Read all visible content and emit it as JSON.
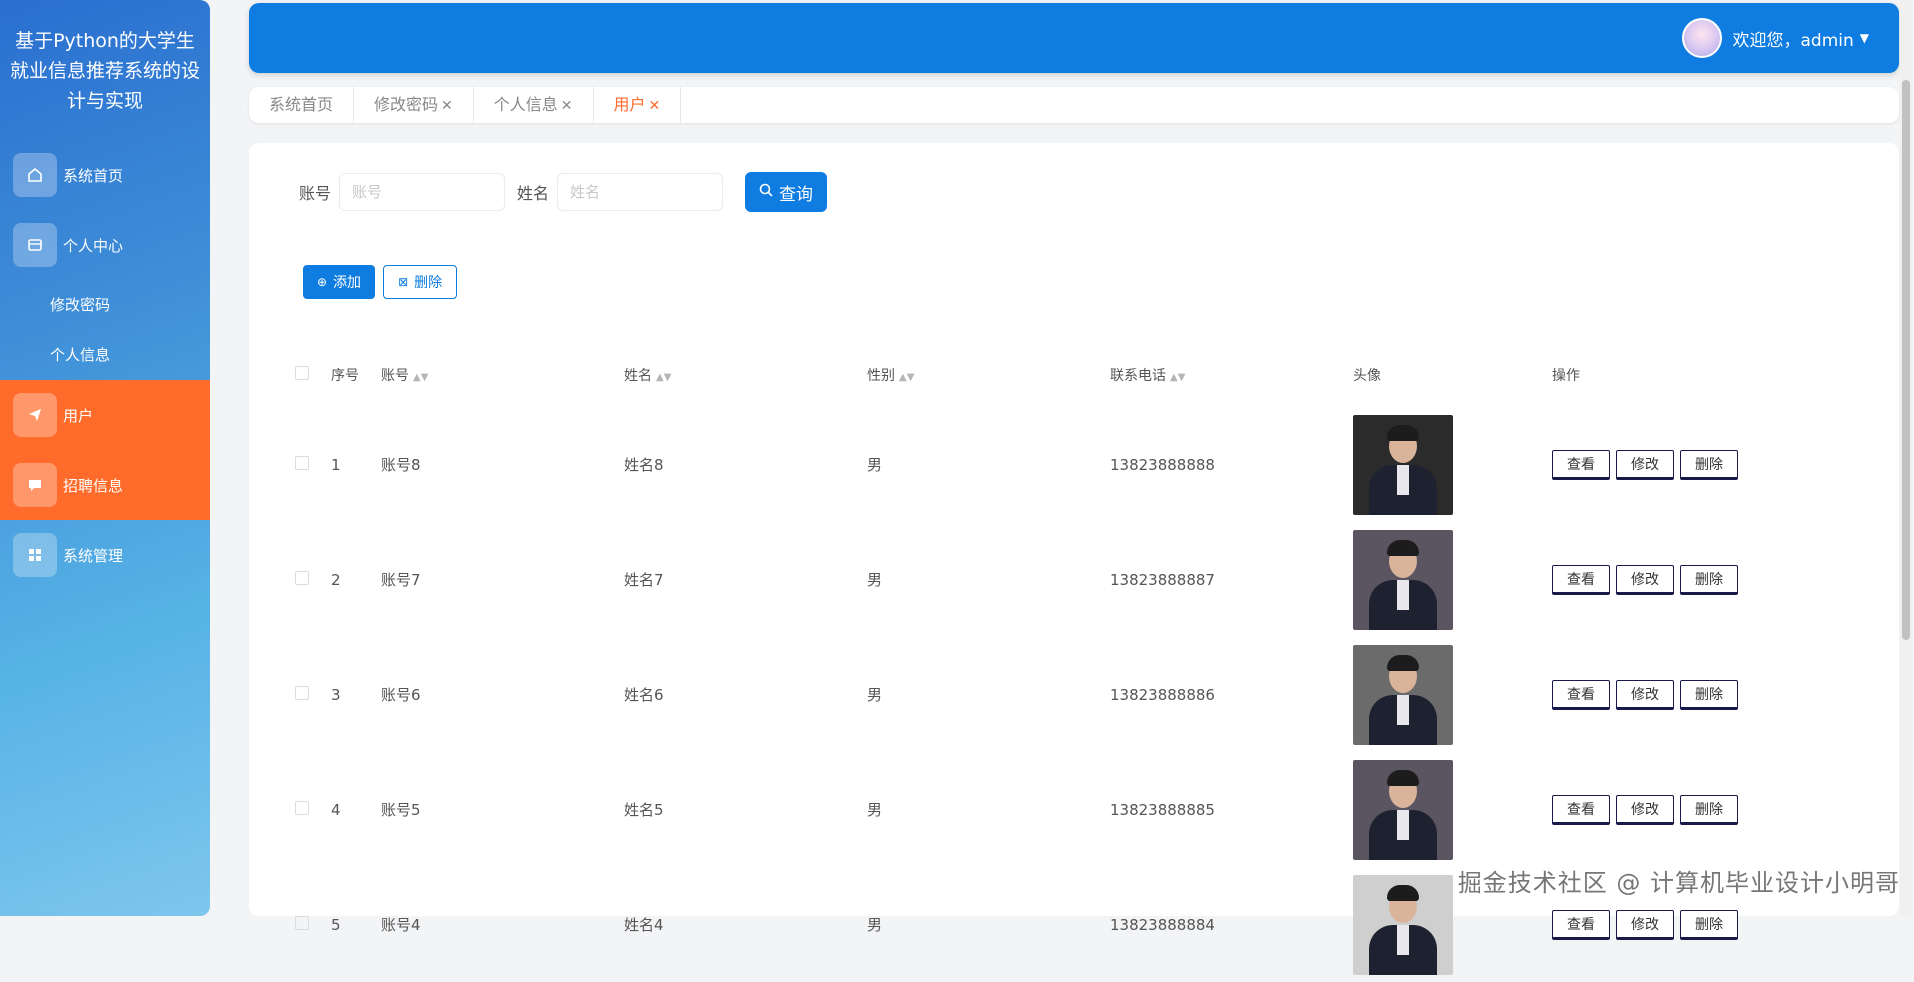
{
  "app": {
    "title": "基于Python的大学生就业信息推荐系统的设计与实现"
  },
  "sidebar": {
    "items": [
      {
        "label": "系统首页",
        "icon": "home-icon"
      },
      {
        "label": "个人中心",
        "icon": "user-center-icon"
      },
      {
        "label": "修改密码"
      },
      {
        "label": "个人信息"
      },
      {
        "label": "用户",
        "icon": "send-icon"
      },
      {
        "label": "招聘信息",
        "icon": "message-icon"
      },
      {
        "label": "系统管理",
        "icon": "grid-icon"
      }
    ],
    "active_color": "#ff6b2b"
  },
  "header": {
    "welcome": "欢迎您，admin",
    "color": "#0e7ce0"
  },
  "tabs": [
    {
      "label": "系统首页",
      "closable": false
    },
    {
      "label": "修改密码",
      "closable": true
    },
    {
      "label": "个人信息",
      "closable": true
    },
    {
      "label": "用户",
      "closable": true,
      "active": true
    }
  ],
  "search": {
    "account_label": "账号",
    "account_placeholder": "账号",
    "name_label": "姓名",
    "name_placeholder": "姓名",
    "query_label": "查询"
  },
  "actions": {
    "add_label": "添加",
    "delete_label": "删除"
  },
  "table": {
    "columns": [
      "序号",
      "账号",
      "姓名",
      "性别",
      "联系电话",
      "头像",
      "操作"
    ],
    "rows": [
      {
        "idx": "1",
        "account": "账号8",
        "name": "姓名8",
        "sex": "男",
        "phone": "13823888888"
      },
      {
        "idx": "2",
        "account": "账号7",
        "name": "姓名7",
        "sex": "男",
        "phone": "13823888887"
      },
      {
        "idx": "3",
        "account": "账号6",
        "name": "姓名6",
        "sex": "男",
        "phone": "13823888886"
      },
      {
        "idx": "4",
        "account": "账号5",
        "name": "姓名5",
        "sex": "男",
        "phone": "13823888885"
      },
      {
        "idx": "5",
        "account": "账号4",
        "name": "姓名4",
        "sex": "男",
        "phone": "13823888884"
      }
    ],
    "row_actions": {
      "view": "查看",
      "edit": "修改",
      "delete": "删除"
    }
  },
  "watermark": "掘金技术社区 @ 计算机毕业设计小明哥"
}
